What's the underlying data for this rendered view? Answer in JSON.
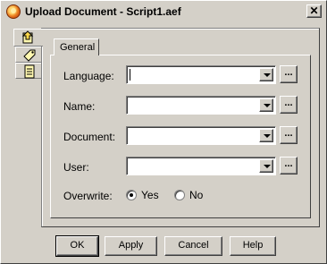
{
  "window": {
    "title": "Upload Document - Script1.aef",
    "close_glyph": "✕"
  },
  "side_tabs": [
    {
      "icon": "upload-document-icon",
      "active": true
    },
    {
      "icon": "tag-icon",
      "active": false
    },
    {
      "icon": "document-list-icon",
      "active": false
    }
  ],
  "tab": {
    "label": "General"
  },
  "fields": [
    {
      "label": "Language:",
      "value": "",
      "browse_label": "..."
    },
    {
      "label": "Name:",
      "value": "",
      "browse_label": "..."
    },
    {
      "label": "Document:",
      "value": "",
      "browse_label": "..."
    },
    {
      "label": "User:",
      "value": "",
      "browse_label": "..."
    }
  ],
  "overwrite": {
    "label": "Overwrite:",
    "options": [
      {
        "label": "Yes",
        "checked": true
      },
      {
        "label": "No",
        "checked": false
      }
    ]
  },
  "buttons": {
    "ok": "OK",
    "apply": "Apply",
    "cancel": "Cancel",
    "help": "Help"
  },
  "colors": {
    "face": "#d4d0c8",
    "shadow": "#808080",
    "dark_shadow": "#404040",
    "highlight": "#ffffff",
    "title_icon_orange": "#e87a1d"
  }
}
